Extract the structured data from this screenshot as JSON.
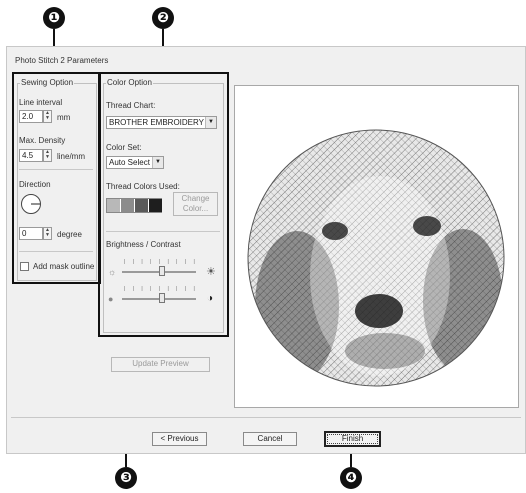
{
  "callouts": [
    "❶",
    "❷",
    "❸",
    "❹"
  ],
  "dialog": {
    "title": "Photo Stitch 2 Parameters"
  },
  "sewing_option": {
    "group_label": "Sewing Option",
    "line_interval_label": "Line interval",
    "line_interval_value": "2.0",
    "line_interval_unit": "mm",
    "max_density_label": "Max. Density",
    "max_density_value": "4.5",
    "max_density_unit": "line/mm",
    "direction_label": "Direction",
    "direction_value": "0",
    "direction_unit": "degree",
    "add_mask_label": "Add mask outline"
  },
  "color_option": {
    "group_label": "Color Option",
    "thread_chart_label": "Thread Chart:",
    "thread_chart_value": "BROTHER EMBROIDERY",
    "color_set_label": "Color Set:",
    "color_set_value": "Auto Select",
    "thread_colors_label": "Thread Colors Used:",
    "change_color_label": "Change Color...",
    "brightness_label": "Brightness / Contrast",
    "swatch_colors": [
      "#b8b8b8",
      "#8c8c8c",
      "#5a5a5a",
      "#1e1e1e"
    ]
  },
  "buttons": {
    "update_preview": "Update Preview",
    "previous": "< Previous",
    "cancel": "Cancel",
    "finish": "Finish"
  }
}
